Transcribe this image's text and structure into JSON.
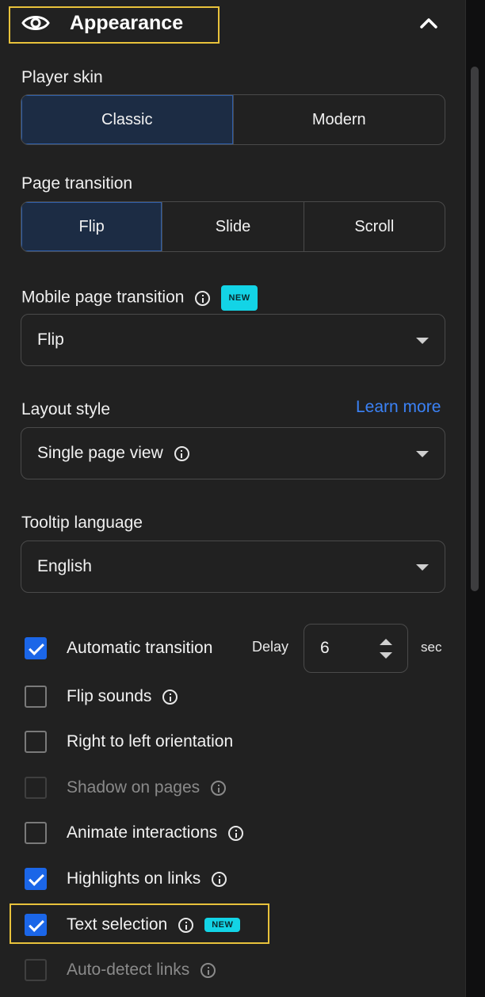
{
  "header": {
    "title": "Appearance",
    "icon": "eye-icon",
    "collapse_icon": "chevron-up-icon"
  },
  "player_skin": {
    "label": "Player skin",
    "options": [
      "Classic",
      "Modern"
    ],
    "selected": "Classic"
  },
  "page_transition": {
    "label": "Page transition",
    "options": [
      "Flip",
      "Slide",
      "Scroll"
    ],
    "selected": "Flip"
  },
  "mobile_page_transition": {
    "label": "Mobile page transition",
    "badge": "NEW",
    "value": "Flip"
  },
  "layout_style": {
    "label": "Layout style",
    "link": "Learn more",
    "value": "Single page view"
  },
  "tooltip_language": {
    "label": "Tooltip language",
    "value": "English"
  },
  "automatic_transition": {
    "label": "Automatic transition",
    "checked": true,
    "delay_label": "Delay",
    "delay_value": "6",
    "unit": "sec"
  },
  "checkboxes": [
    {
      "label": "Flip sounds",
      "checked": false,
      "info": true
    },
    {
      "label": "Right to left orientation",
      "checked": false,
      "info": false
    },
    {
      "label": "Shadow on pages",
      "checked": false,
      "disabled": true,
      "info": true
    },
    {
      "label": "Animate interactions",
      "checked": false,
      "info": true
    },
    {
      "label": "Highlights on links",
      "checked": true,
      "info": true
    },
    {
      "label": "Text selection",
      "checked": true,
      "info": true,
      "badge": "NEW"
    },
    {
      "label": "Auto-detect links",
      "checked": false,
      "disabled": true,
      "info": true
    }
  ],
  "colors": {
    "panel": "#212121",
    "accent": "#1b66e8",
    "link": "#3b82f6",
    "badge": "#13d4e6",
    "highlight": "#e8c23b"
  }
}
